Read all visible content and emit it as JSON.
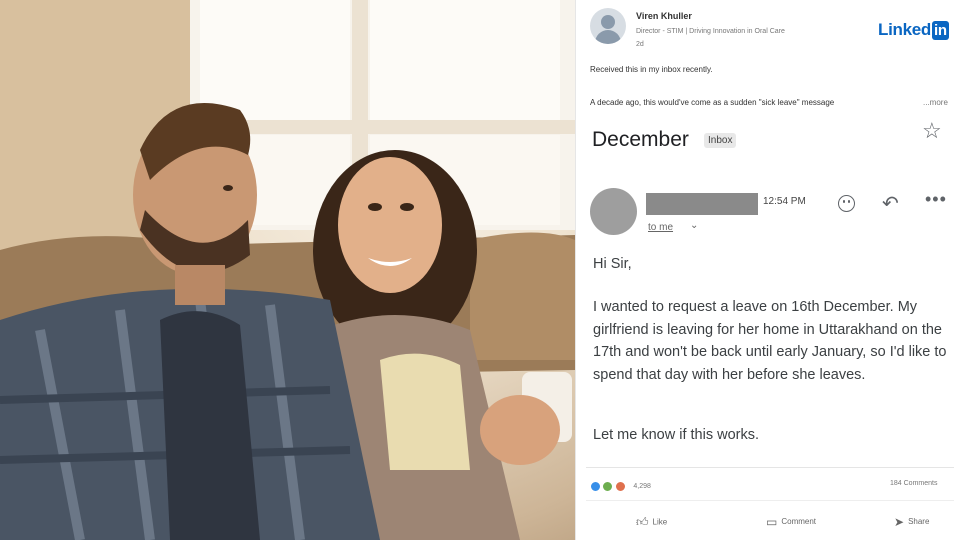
{
  "linkedin": {
    "logo_text": "Linked",
    "logo_in": "in",
    "author_name": "Viren Khuller",
    "author_title": "Director - STIM | Driving Innovation in Oral Care",
    "post_age": "2d",
    "post_line1": "Received this in my inbox recently.",
    "post_line2": "A decade ago, this would've come as a sudden \"sick leave\" message",
    "more_link": "...more",
    "reaction_count": "4,298",
    "comments_count": "184 Comments",
    "actions": {
      "like": "Like",
      "comment": "Comment",
      "share": "Share"
    },
    "colors": {
      "brand": "#0a66c2",
      "like": "#378fe9",
      "celebrate": "#6dae4f",
      "love": "#df704d"
    }
  },
  "email": {
    "subject": "December",
    "label": "Inbox",
    "time": "12:54 PM",
    "recipient": "to me",
    "greeting": "Hi Sir,",
    "body": "I wanted to request a leave on 16th December. My girlfriend is leaving for her home in Uttarakhand on the 17th and won't be back until early January, so I'd like to spend that day with her before she leaves.",
    "closing": "Let me know if this works."
  },
  "icons": {
    "star": "star-icon",
    "emoji": "emoji-icon",
    "reply": "reply-icon",
    "more": "more-vertical-icon",
    "caret": "chevron-down-icon"
  }
}
